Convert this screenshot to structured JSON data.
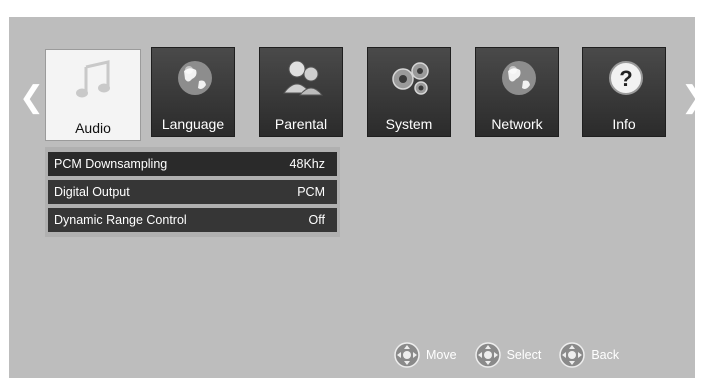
{
  "nav": {
    "left_arrow_icon": "chevron-left-icon",
    "right_arrow_icon": "chevron-right-icon",
    "tabs": [
      {
        "id": "audio",
        "label": "Audio",
        "icon": "music-note-icon",
        "active": true
      },
      {
        "id": "language",
        "label": "Language",
        "icon": "globe-icon",
        "active": false
      },
      {
        "id": "parental",
        "label": "Parental",
        "icon": "users-icon",
        "active": false
      },
      {
        "id": "system",
        "label": "System",
        "icon": "gears-icon",
        "active": false
      },
      {
        "id": "network",
        "label": "Network",
        "icon": "globe-icon",
        "active": false
      },
      {
        "id": "info",
        "label": "Info",
        "icon": "question-icon",
        "active": false
      }
    ]
  },
  "audio_menu": {
    "items": [
      {
        "label": "PCM Downsampling",
        "value": "48Khz"
      },
      {
        "label": "Digital Output",
        "value": "PCM"
      },
      {
        "label": "Dynamic Range Control",
        "value": "Off"
      }
    ]
  },
  "hints": [
    {
      "icon": "dpad-icon",
      "label": "Move"
    },
    {
      "icon": "dpad-icon",
      "label": "Select"
    },
    {
      "icon": "dpad-icon",
      "label": "Back"
    }
  ],
  "colors": {
    "background": "#bdbdbd",
    "tab_dark": "#2b2b2b",
    "tab_active": "#f4f4f4",
    "row": "#363636"
  }
}
